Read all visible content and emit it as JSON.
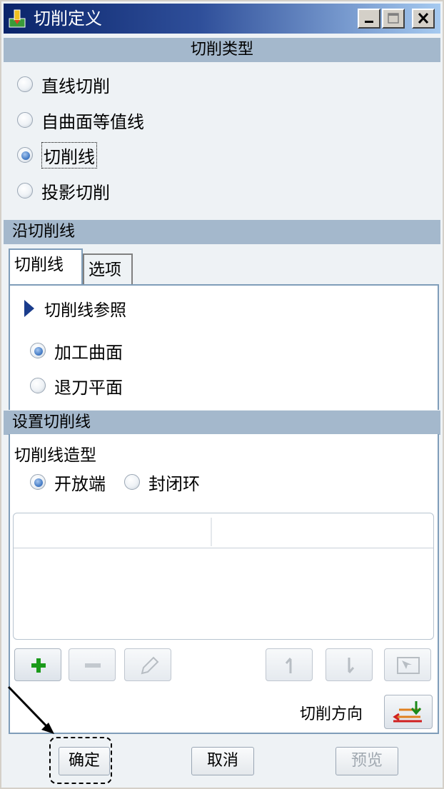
{
  "window": {
    "title": "切削定义",
    "icon": "app-icon",
    "controls": [
      "minimize-icon",
      "maximize-icon",
      "close-icon"
    ]
  },
  "cut_type": {
    "header": "切削类型",
    "options": [
      "直线切削",
      "自曲面等值线",
      "切削线",
      "投影切削"
    ],
    "selected": "切削线"
  },
  "along_header": "沿切削线",
  "tabs": [
    "切削线",
    "选项"
  ],
  "tab_panel": {
    "reference_label": "切削线参照",
    "options": [
      "加工曲面",
      "退刀平面"
    ],
    "selected": "加工曲面"
  },
  "setup": {
    "header": "设置切削线",
    "shape_label": "切削线造型",
    "shape_options": [
      "开放端",
      "封闭环"
    ],
    "shape_selected": "开放端"
  },
  "toolbar": {
    "buttons": [
      "add-icon",
      "remove-icon",
      "edit-icon",
      "move-up-icon",
      "move-down-icon",
      "reorder-icon"
    ]
  },
  "direction": {
    "label": "切削方向",
    "icon": "cut-direction-icon"
  },
  "footer": {
    "ok": "确定",
    "cancel": "取消",
    "preview": "预览"
  },
  "colors": {
    "title_bar": "#0a246a",
    "section_header": "#a4b8cc",
    "radio_checked": "#4a80c8"
  }
}
